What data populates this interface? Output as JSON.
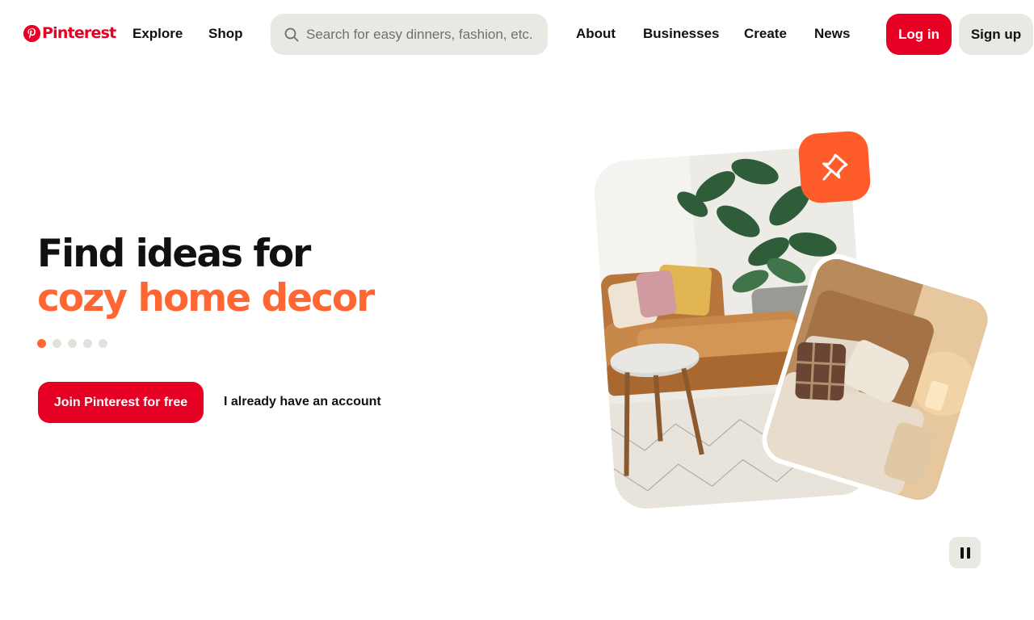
{
  "header": {
    "logo_text": "Pinterest",
    "nav_left": [
      {
        "label": "Explore"
      },
      {
        "label": "Shop"
      }
    ],
    "search": {
      "placeholder": "Search for easy dinners, fashion, etc."
    },
    "nav_right": [
      {
        "label": "About"
      },
      {
        "label": "Businesses"
      },
      {
        "label": "Create"
      },
      {
        "label": "News"
      }
    ],
    "login_label": "Log in",
    "signup_label": "Sign up"
  },
  "hero": {
    "headline_line1": "Find ideas for",
    "headline_line2": "cozy home decor",
    "carousel": {
      "total": 5,
      "active_index": 0
    },
    "join_label": "Join Pinterest for free",
    "account_label": "I already have an account"
  },
  "icons": {
    "logo": "pinterest-logo-icon",
    "search": "search-icon",
    "pin_badge": "pushpin-icon",
    "pause": "pause-icon"
  },
  "colors": {
    "brand_red": "#e60023",
    "accent_orange": "#ff6633",
    "pin_badge": "#ff5c2b",
    "neutral_button": "#e9e9e4",
    "text": "#111111"
  }
}
